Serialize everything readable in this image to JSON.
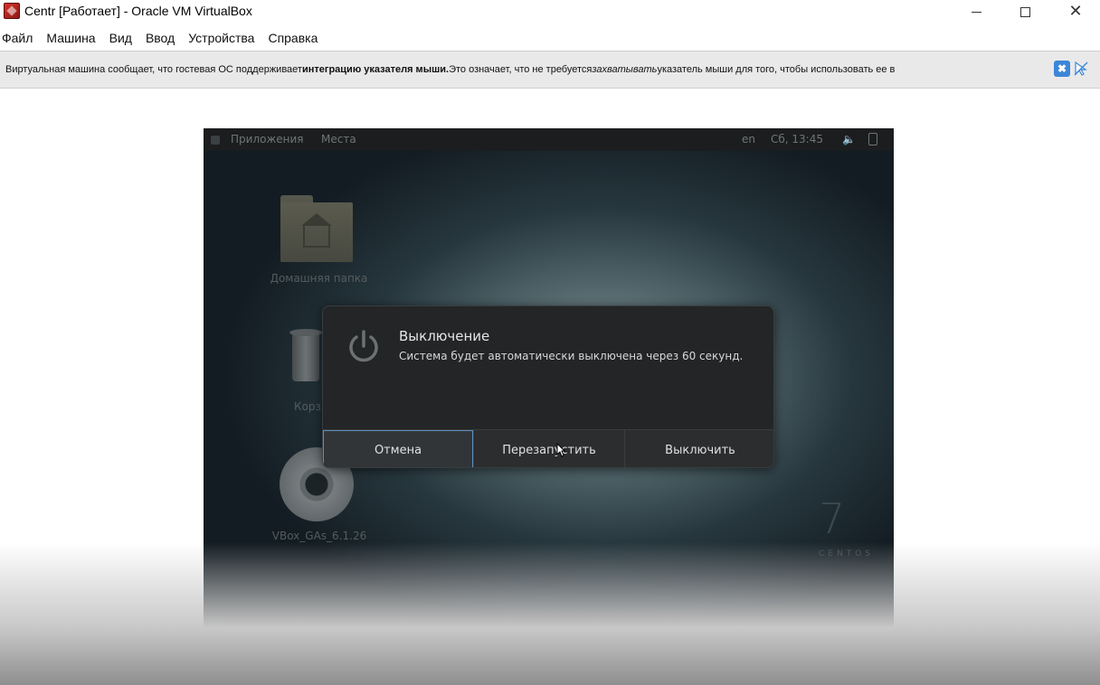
{
  "window": {
    "title": "Centr [Работает] - Oracle VM VirtualBox",
    "minimize_icon": "minimize-icon",
    "maximize_icon": "maximize-icon",
    "close_icon": "close-icon",
    "close_glyph": "✕"
  },
  "menu": [
    "Файл",
    "Машина",
    "Вид",
    "Ввод",
    "Устройства",
    "Справка"
  ],
  "notice": {
    "part1": "Виртуальная машина сообщает, что гостевая ОС поддерживает ",
    "bold": "интеграцию указателя мыши.",
    "part2": " Это означает, что не требуется ",
    "italic": "захватывать",
    "part3": " указатель мыши для того, чтобы использовать ее в",
    "close_glyph": "✖"
  },
  "guest": {
    "topbar": {
      "applications": "Приложения",
      "places": "Места",
      "language": "en",
      "clock": "Сб, 13:45",
      "volume_glyph": "🔈"
    },
    "desktop": {
      "home_folder": "Домашняя папка",
      "trash": "Корз",
      "disc": "VBox_GAs_6.1.26"
    },
    "brand": {
      "number": "7",
      "word": "CENTOS"
    }
  },
  "dialog": {
    "title": "Выключение",
    "message": "Система будет автоматически выключена через 60 секунд.",
    "buttons": {
      "cancel": "Отмена",
      "restart": "Перезапустить",
      "power_off": "Выключить"
    }
  }
}
